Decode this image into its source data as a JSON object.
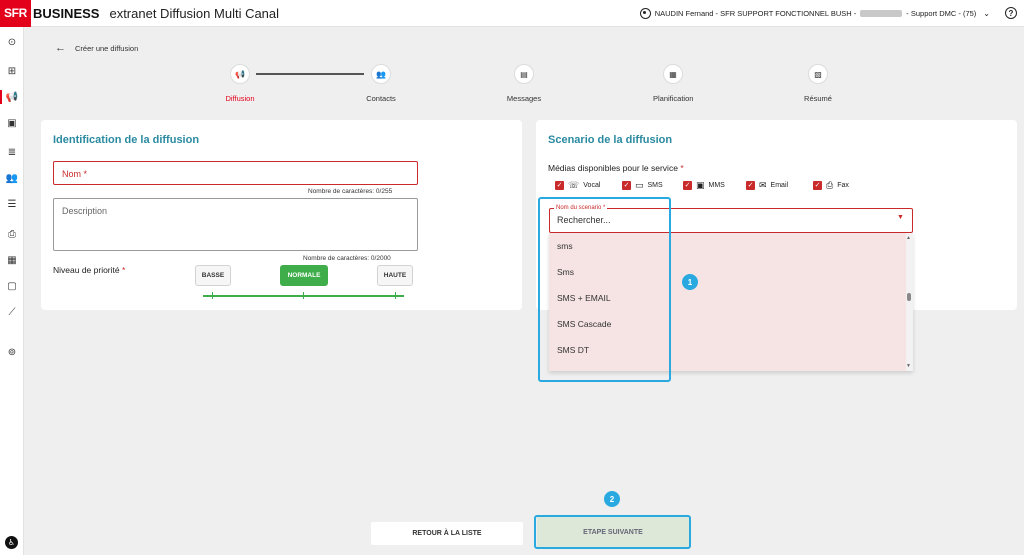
{
  "header": {
    "brand_sfr": "SFR",
    "brand_business": "BUSINESS",
    "app_title": "extranet Diffusion Multi Canal",
    "user_name": "NAUDIN Fernand - SFR SUPPORT FONCTIONNEL BUSH -",
    "user_suffix": "- Support DMC - (75)",
    "help": "?"
  },
  "breadcrumb": {
    "back_label": "Créer une diffusion"
  },
  "stepper": {
    "steps": [
      {
        "label": "Diffusion",
        "icon": "megaphone-icon"
      },
      {
        "label": "Contacts",
        "icon": "group-icon"
      },
      {
        "label": "Messages",
        "icon": "chat-icon"
      },
      {
        "label": "Planification",
        "icon": "calendar-icon"
      },
      {
        "label": "Résumé",
        "icon": "document-search-icon"
      }
    ]
  },
  "identification": {
    "title": "Identification de la diffusion",
    "name_placeholder": "Nom *",
    "name_counter": "Nombre de caractères: 0/255",
    "description_placeholder": "Description",
    "description_counter": "Nombre de caractères: 0/2000",
    "priority_label": "Niveau de priorité",
    "priority_required": "*",
    "priority_options": [
      "BASSE",
      "NORMALE",
      "HAUTE"
    ],
    "priority_selected": "NORMALE"
  },
  "scenario": {
    "title": "Scenario de la diffusion",
    "media_label": "Médias disponibles pour le service",
    "media_required": "*",
    "media": [
      {
        "label": "Vocal",
        "checked": true,
        "icon": "phone-icon"
      },
      {
        "label": "SMS",
        "checked": true,
        "icon": "sms-icon"
      },
      {
        "label": "MMS",
        "checked": true,
        "icon": "mms-icon"
      },
      {
        "label": "Email",
        "checked": true,
        "icon": "email-icon"
      },
      {
        "label": "Fax",
        "checked": true,
        "icon": "fax-icon"
      }
    ],
    "scenario_field_label": "Nom du scenario *",
    "scenario_search_placeholder": "Rechercher...",
    "options": [
      "sms",
      "Sms",
      "SMS + EMAIL",
      "SMS Cascade",
      "SMS DT"
    ]
  },
  "annotations": {
    "badge_1": "1",
    "badge_2": "2",
    "color": "#29a9e0"
  },
  "footer": {
    "back_button": "RETOUR À LA LISTE",
    "next_button": "ETAPE SUIVANTE"
  },
  "colors": {
    "brand_red": "#e2001a",
    "teal_title": "#2a8aa0",
    "green": "#3fae4a"
  }
}
